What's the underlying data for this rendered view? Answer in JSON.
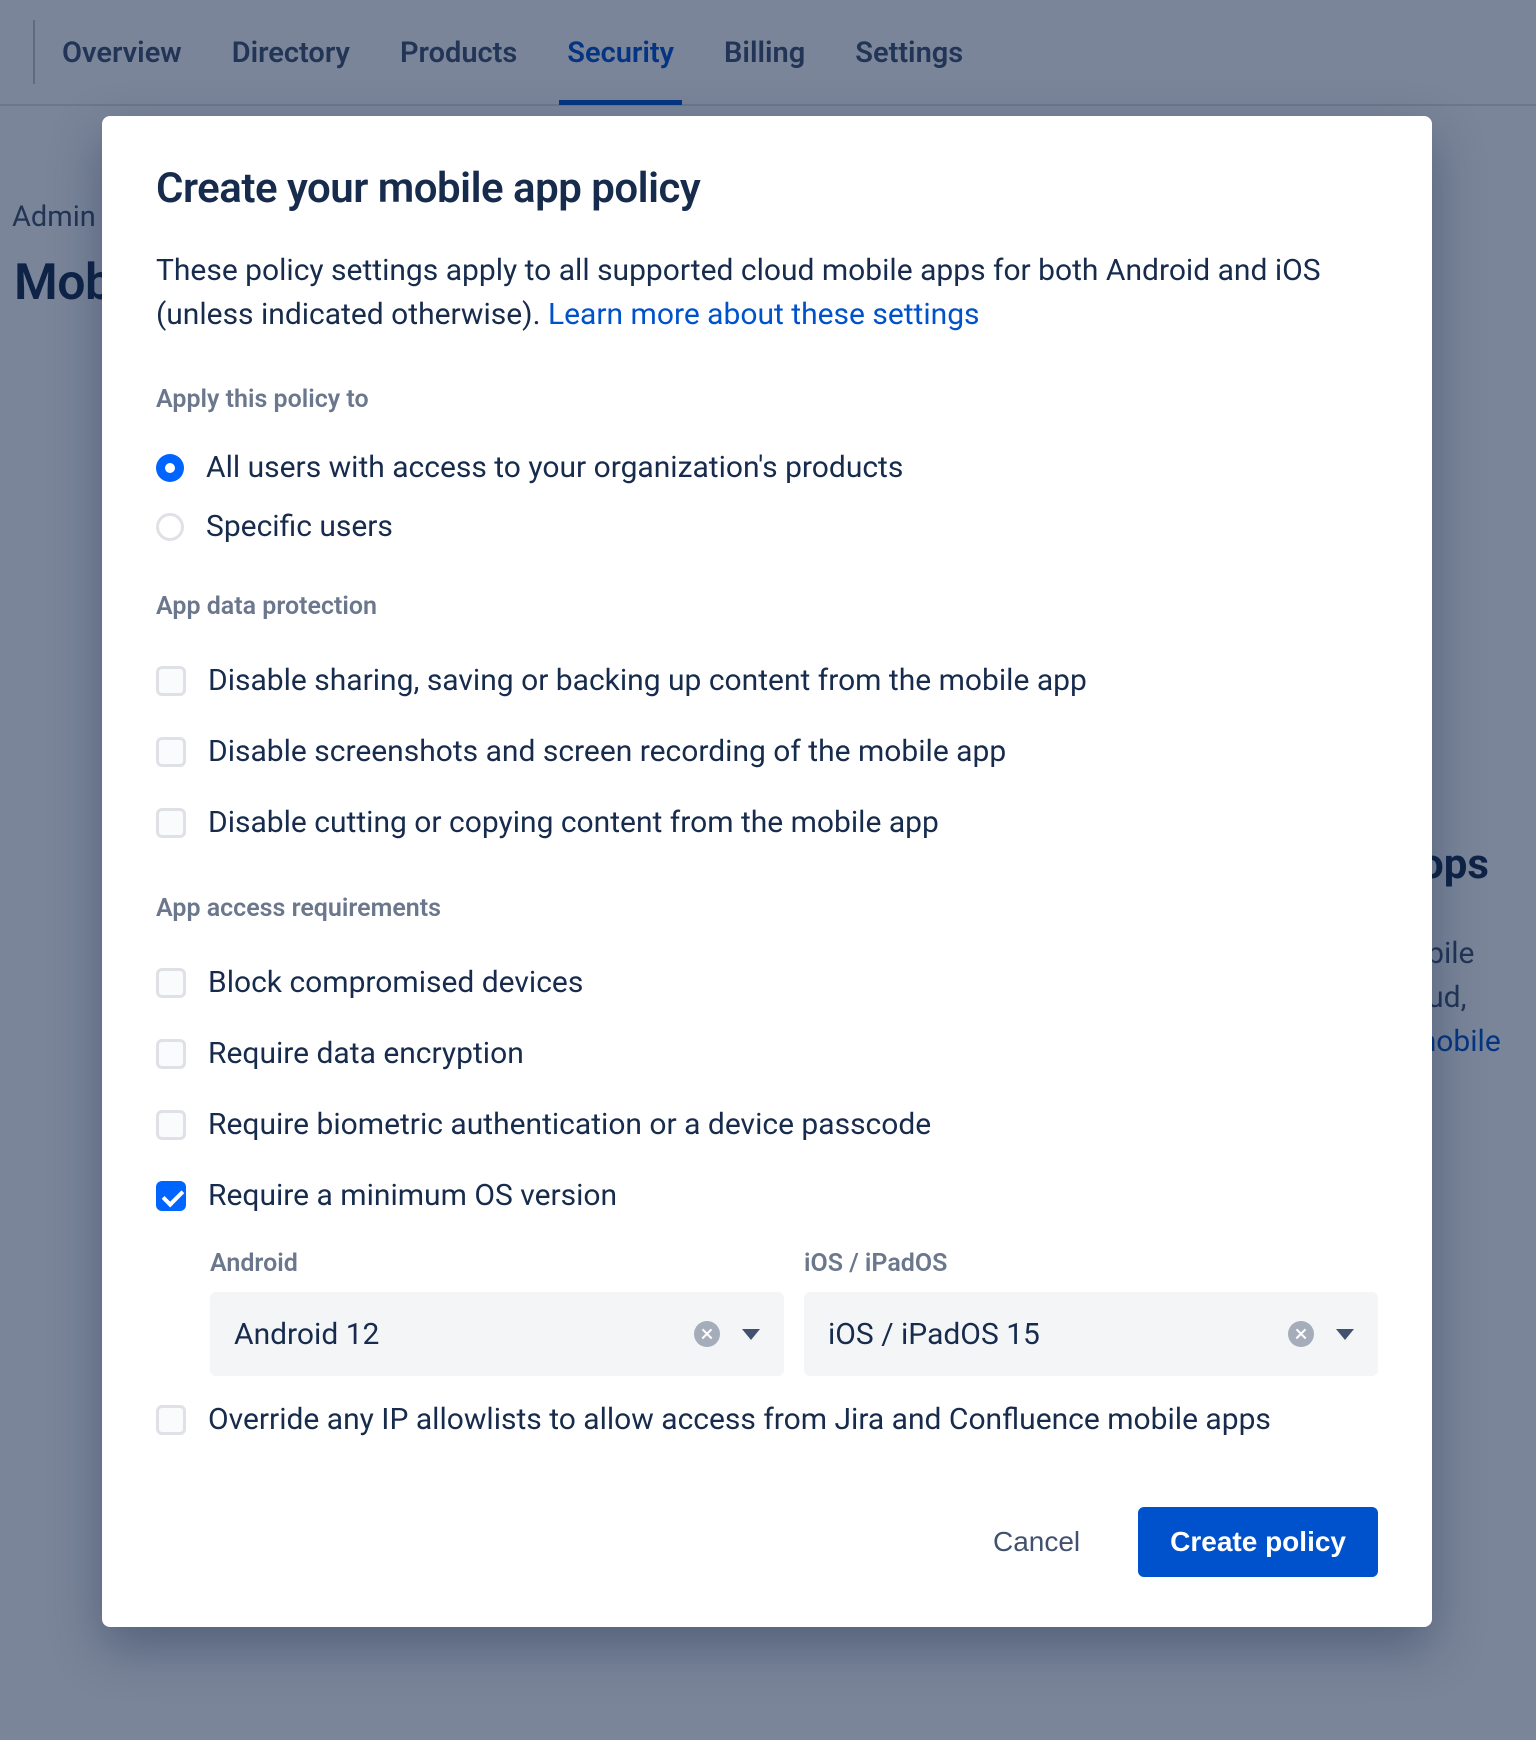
{
  "tabs": [
    "Overview",
    "Directory",
    "Products",
    "Security",
    "Billing",
    "Settings"
  ],
  "active_tab_index": 3,
  "breadcrumb": "Admin",
  "page_title": "Mob",
  "bg_hint_title": "ops",
  "bg_hint_line1": "obile",
  "bg_hint_line2": "oud,",
  "bg_hint_link": "mobile",
  "modal": {
    "title": "Create your mobile app policy",
    "lead": "These policy settings apply to all supported cloud mobile apps for both Android and iOS (unless indicated otherwise). ",
    "lead_link": "Learn more about these settings",
    "section_apply": "Apply this policy to",
    "apply_options": [
      {
        "label": "All users with access to your organization's products",
        "checked": true
      },
      {
        "label": "Specific users",
        "checked": false
      }
    ],
    "section_data": "App data protection",
    "data_options": [
      {
        "label": "Disable sharing, saving or backing up content from the mobile app",
        "checked": false
      },
      {
        "label": "Disable screenshots and screen recording of the mobile app",
        "checked": false
      },
      {
        "label": "Disable cutting or copying content from the mobile app",
        "checked": false
      }
    ],
    "section_access": "App access requirements",
    "access_options": [
      {
        "label": "Block compromised devices",
        "checked": false
      },
      {
        "label": "Require data encryption",
        "checked": false
      },
      {
        "label": "Require biometric authentication or a device passcode",
        "checked": false
      },
      {
        "label": "Require a minimum OS version",
        "checked": true
      },
      {
        "label": "Override any IP allowlists to allow access from Jira and Confluence mobile apps",
        "checked": false
      }
    ],
    "os": {
      "android_label": "Android",
      "android_value": "Android 12",
      "ios_label": "iOS / iPadOS",
      "ios_value": "iOS / iPadOS 15"
    },
    "cancel": "Cancel",
    "submit": "Create policy"
  }
}
